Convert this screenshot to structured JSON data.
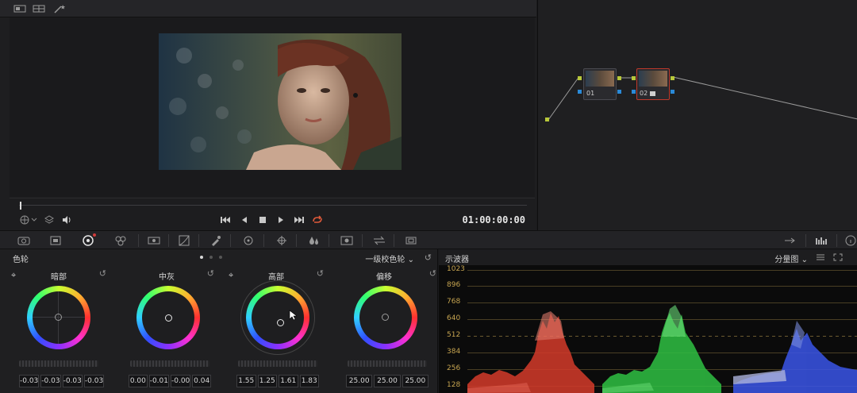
{
  "viewer": {
    "timecode": "01:00:00:00"
  },
  "nodes": [
    {
      "label": "01"
    },
    {
      "label": "02"
    }
  ],
  "wheels_panel": {
    "title": "色轮",
    "mode": "一级校色轮",
    "wheels": [
      {
        "name": "暗部",
        "values": [
          "-0.03",
          "-0.03",
          "-0.03",
          "-0.03"
        ]
      },
      {
        "name": "中灰",
        "values": [
          "0.00",
          "-0.01",
          "-0.00",
          "0.04"
        ]
      },
      {
        "name": "高部",
        "values": [
          "1.55",
          "1.25",
          "1.61",
          "1.83"
        ]
      },
      {
        "name": "偏移",
        "values": [
          "25.00",
          "25.00",
          "25.00"
        ]
      }
    ]
  },
  "scope_panel": {
    "title": "示波器",
    "mode": "分量图",
    "ticks": [
      "1023",
      "896",
      "768",
      "640",
      "512",
      "384",
      "256",
      "128"
    ]
  },
  "colors": {
    "accent_red": "#c0392b",
    "scope_tick": "#c6a450",
    "record_loop": "#e05a3a"
  }
}
